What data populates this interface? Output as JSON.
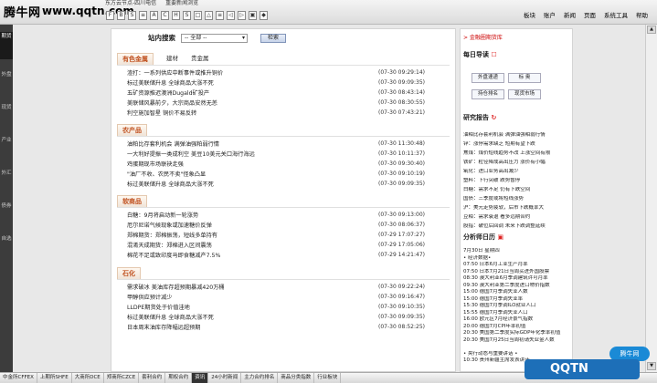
{
  "topbar": {
    "logo_main": "腾牛网",
    "logo_url": "www.qqtn.com",
    "tabs": [
      "东方云节点-四川电信",
      "重要新闻浏览"
    ],
    "toolbar": [
      "F",
      "B",
      "S",
      "≡",
      "A",
      "C",
      "H",
      "S",
      "□",
      "△",
      "≡",
      "◁",
      "▷",
      "▣",
      "◆"
    ],
    "menu": [
      "板块",
      "账户",
      "新闻",
      "页面",
      "系统工具",
      "帮助"
    ]
  },
  "left_tabs": [
    "期货",
    "外盘",
    "现货",
    "产业",
    "外汇",
    "债券",
    "自选"
  ],
  "search": {
    "label": "站内搜索",
    "select": "-- 全部 --",
    "button": "检索"
  },
  "sections": [
    {
      "title": "有色金属",
      "tabs": [
        "建材",
        "贵金属"
      ],
      "items": [
        {
          "title": "渣打：一系列供应中断事件或推升铜价",
          "time": "(07-30 09:29:14)"
        },
        {
          "title": "标过美联储升息 全球商品大涨不死",
          "time": "(07-30 09:09:35)"
        },
        {
          "title": "五矿资源推迟澳洲Dugald矿投产",
          "time": "(07-30 08:43:14)"
        },
        {
          "title": "美联储风暴前夕，大宗商品安然无恙",
          "time": "(07-30 08:30:55)"
        },
        {
          "title": "利空施加智星 铜价不易反转",
          "time": "(07-30 07:43:21)"
        }
      ]
    },
    {
      "title": "农产品",
      "tabs": [],
      "items": [
        {
          "title": "油粕比存套利机会 满弹油强粕弱行情",
          "time": "(07-30 11:30:48)"
        },
        {
          "title": "一大利好提振一类成利空 美豆10美元关口海行海远",
          "time": "(07-30 10:11:37)"
        },
        {
          "title": "鸡蛋期现市场联袂走强",
          "time": "(07-30 09:30:40)"
        },
        {
          "title": "\"油厂不收、农民不卖\"怪象凸显",
          "time": "(07-30 09:10:19)"
        },
        {
          "title": "标过美联储升息 全球商品大涨不死",
          "time": "(07-30 09:09:35)"
        }
      ]
    },
    {
      "title": "软商品",
      "tabs": [],
      "items": [
        {
          "title": "白糖：9月将启动新一轮涨势",
          "time": "(07-30 09:13:00)"
        },
        {
          "title": "厄尔尼诺气候现象或加速糖价反弹",
          "time": "(07-30 08:06:37)"
        },
        {
          "title": "郑棉期货：郑棉振荡，短线多单持有",
          "time": "(07-29 17:07:27)"
        },
        {
          "title": "混淆天成期货：郑棉进入区间震荡",
          "time": "(07-29 17:05:06)"
        },
        {
          "title": "棉花不足或致印度马即食糖减产7.5%",
          "time": "(07-29 14:21:47)"
        }
      ]
    },
    {
      "title": "石化",
      "tabs": [],
      "items": [
        {
          "title": "需求破冰 美油库存超预期暴减420万桶",
          "time": "(07-30 09:22:24)"
        },
        {
          "title": "甲醇供应预计减少",
          "time": "(07-30 09:16:47)"
        },
        {
          "title": "LLDPE期货处于价值洼地",
          "time": "(07-30 09:10:35)"
        },
        {
          "title": "标过美联储升息 全球商品大涨不死",
          "time": "(07-30 09:09:35)"
        },
        {
          "title": "日本周末油库存降幅远超预期",
          "time": "(07-30 08:52:25)"
        }
      ]
    }
  ],
  "sidebar": {
    "top_link": "> 金融圈期货库",
    "nav_title": "每日导读",
    "nav_icon": "☐",
    "nav_buttons": [
      "外盘速递",
      "标 奥",
      "持仓排名",
      "现货市场"
    ],
    "report_title": "研究报告",
    "report_icon": "↻",
    "report_lines": [
      "油粕比存套利机会 满弹油强粕弱行情",
      "锌：涨停需求缺乏 短期有望下跌",
      "焦煤：煤价短线趋势不改 上涨空间有限",
      "铁矿：粒径降成高出压力 涨价有小幅",
      "氧化：进口业务高出减少",
      "塑料：下行突破 跌势暂停",
      "白糖：需求不足 仍有下跌空间",
      "国债：三季度或将短线涨势",
      "沪：美元走势疲软，后市下跌概率大",
      "豆粕：需求衰退 看多远期合约",
      "股指：破位后回调 未来下跌调整延续"
    ],
    "calendar_title": "分析师日历",
    "calendar_icon": "▣",
    "calendar_lines": [
      "7月30日 星期四",
      "• 经济数据•",
      "07:50  日本6月工业生产月率",
      "07:50  日本7月21日当周买进外国股票",
      "08:30  澳大利亚6月季调建筑许可月率",
      "09:30  澳大利亚第二季度进口物价指数",
      "15:00  德国7月季调失业人数",
      "15:00  德国7月季调失业率",
      "15:30  德国7月季调ILO就业人口",
      "15:55  德国7月季调失业人口",
      "16:00  欧元区7月经济景气指数",
      "20:00  德国7月CPI年率初值",
      "20:30  美国第二季度实际GDP年化季率初值",
      "20:30  美国7月25日当周初请失业金人数",
      "",
      "• 央行动态与重要讲话 •",
      "10:30  贵州新疆主席发表讲话"
    ]
  },
  "bottom_tabs": [
    "中金所CFFEX",
    "上期所SHFE",
    "大商所DCE",
    "郑商所CZCE",
    "套利合约",
    "期权合约",
    "资讯",
    "24小时新闻",
    "主力合约排名",
    "商品分类指数",
    "行业板块"
  ],
  "bottom_active": 6,
  "watermark": {
    "bottom_brand": "QQTN",
    "bottom_small": "腾牛网"
  }
}
